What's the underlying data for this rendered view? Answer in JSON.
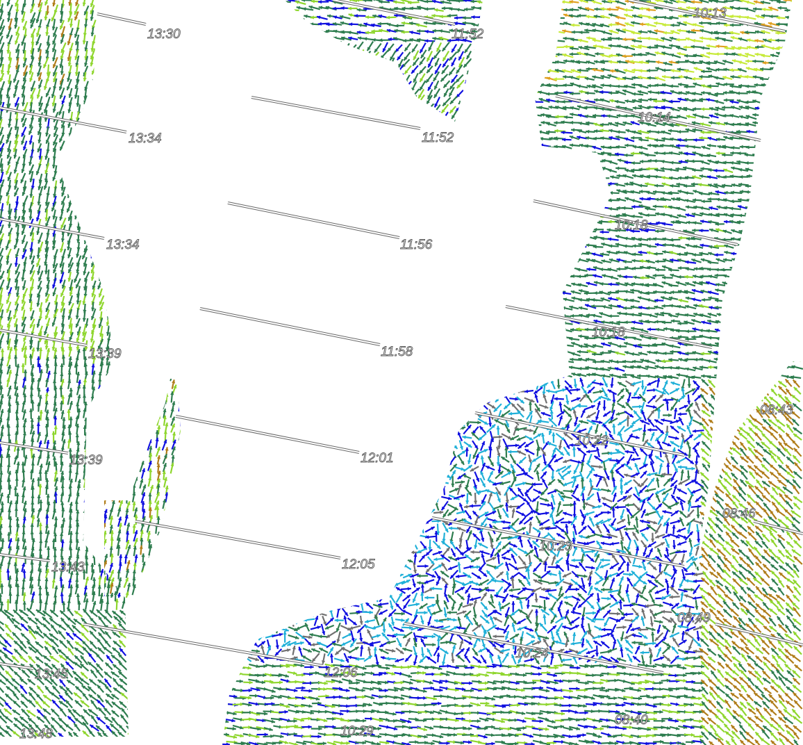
{
  "map": {
    "colors": {
      "background": "#ffffff",
      "track": "#666666",
      "label_stroke": "#555555",
      "wind_dark_green": "#2e7d4f",
      "wind_light_green": "#8fd62e",
      "wind_yellow_green": "#c7ea3a",
      "wind_brown": "#b07d1a",
      "wind_orange": "#e0a020",
      "wind_blue": "#1010e0",
      "wind_cyan": "#20b0d8",
      "wind_gray": "#707070"
    },
    "tracks": [
      {
        "label": "13:30"
      },
      {
        "label": "13:34"
      },
      {
        "label": "13:34"
      },
      {
        "label": "13:39"
      },
      {
        "label": "13:39"
      },
      {
        "label": "13:43"
      },
      {
        "label": "13:45"
      },
      {
        "label": "13:48"
      },
      {
        "label": "11:52"
      },
      {
        "label": "11:52"
      },
      {
        "label": "11:56"
      },
      {
        "label": "11:58"
      },
      {
        "label": "12:01"
      },
      {
        "label": "12:05"
      },
      {
        "label": "12:06"
      },
      {
        "label": "10:29"
      },
      {
        "label": "10:13"
      },
      {
        "label": "10:14"
      },
      {
        "label": "10:18"
      },
      {
        "label": "10:18"
      },
      {
        "label": "10:22"
      },
      {
        "label": "10:23"
      },
      {
        "label": "10:24"
      },
      {
        "label": "08:40"
      },
      {
        "label": "08:43"
      },
      {
        "label": "08:46"
      },
      {
        "label": "08:49"
      }
    ]
  }
}
